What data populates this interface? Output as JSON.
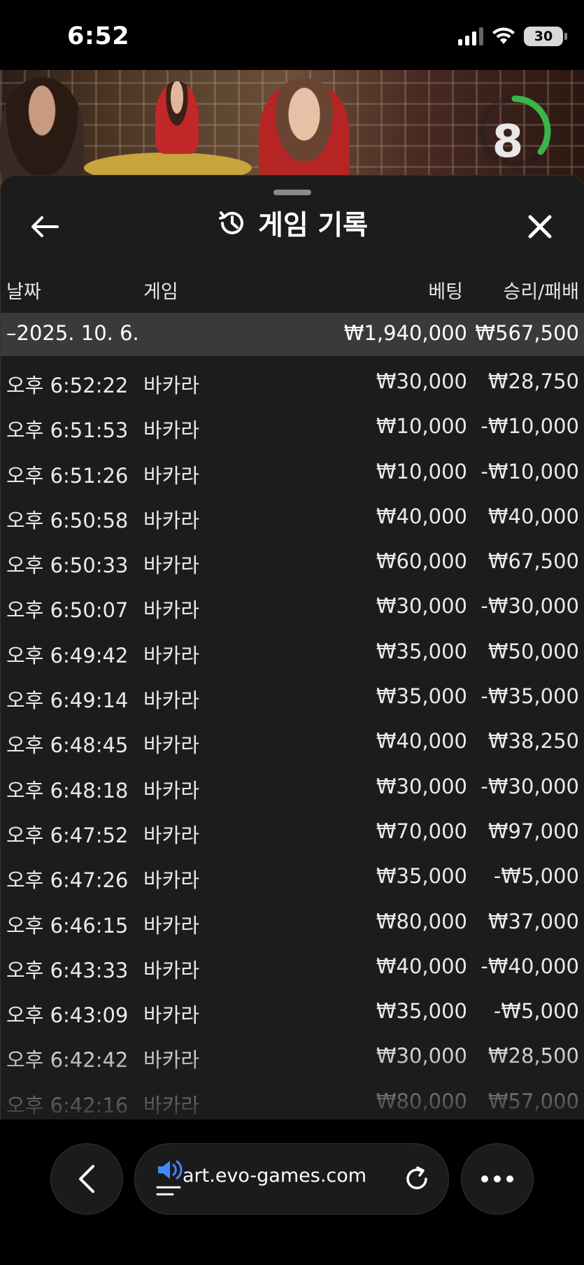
{
  "status_bar": {
    "time": "6:52",
    "battery": "30"
  },
  "video": {
    "countdown": "8",
    "countdown_color": "#3ab54a"
  },
  "panel": {
    "title": "게임 기록",
    "columns": {
      "date": "날짜",
      "game": "게임",
      "bet": "베팅",
      "win_loss": "승리/패배"
    },
    "summary": {
      "date": "–2025. 10. 6.",
      "bet": "₩1,940,000",
      "win_loss": "₩567,500"
    },
    "rows": [
      {
        "time": "오후 6:52:22",
        "game": "바카라",
        "bet": "₩30,000",
        "win_loss": "₩28,750"
      },
      {
        "time": "오후 6:51:53",
        "game": "바카라",
        "bet": "₩10,000",
        "win_loss": "-₩10,000"
      },
      {
        "time": "오후 6:51:26",
        "game": "바카라",
        "bet": "₩10,000",
        "win_loss": "-₩10,000"
      },
      {
        "time": "오후 6:50:58",
        "game": "바카라",
        "bet": "₩40,000",
        "win_loss": "₩40,000"
      },
      {
        "time": "오후 6:50:33",
        "game": "바카라",
        "bet": "₩60,000",
        "win_loss": "₩67,500"
      },
      {
        "time": "오후 6:50:07",
        "game": "바카라",
        "bet": "₩30,000",
        "win_loss": "-₩30,000"
      },
      {
        "time": "오후 6:49:42",
        "game": "바카라",
        "bet": "₩35,000",
        "win_loss": "₩50,000"
      },
      {
        "time": "오후 6:49:14",
        "game": "바카라",
        "bet": "₩35,000",
        "win_loss": "-₩35,000"
      },
      {
        "time": "오후 6:48:45",
        "game": "바카라",
        "bet": "₩40,000",
        "win_loss": "₩38,250"
      },
      {
        "time": "오후 6:48:18",
        "game": "바카라",
        "bet": "₩30,000",
        "win_loss": "-₩30,000"
      },
      {
        "time": "오후 6:47:52",
        "game": "바카라",
        "bet": "₩70,000",
        "win_loss": "₩97,000"
      },
      {
        "time": "오후 6:47:26",
        "game": "바카라",
        "bet": "₩35,000",
        "win_loss": "-₩5,000"
      },
      {
        "time": "오후 6:46:15",
        "game": "바카라",
        "bet": "₩80,000",
        "win_loss": "₩37,000"
      },
      {
        "time": "오후 6:43:33",
        "game": "바카라",
        "bet": "₩40,000",
        "win_loss": "-₩40,000"
      },
      {
        "time": "오후 6:43:09",
        "game": "바카라",
        "bet": "₩35,000",
        "win_loss": "-₩5,000"
      },
      {
        "time": "오후 6:42:42",
        "game": "바카라",
        "bet": "₩30,000",
        "win_loss": "₩28,500"
      },
      {
        "time": "오후 6:42:16",
        "game": "바카라",
        "bet": "₩80,000",
        "win_loss": "₩57,000"
      }
    ]
  },
  "browser": {
    "url": "art.evo-games.com",
    "sound_icon_color": "#3d8bff"
  },
  "icons": {
    "back": "arrow-left-icon",
    "history": "history-clock-icon",
    "close": "close-icon",
    "nav_back": "chevron-left-icon",
    "sound": "speaker-icon",
    "reload": "reload-icon",
    "more": "more-dots-icon"
  }
}
